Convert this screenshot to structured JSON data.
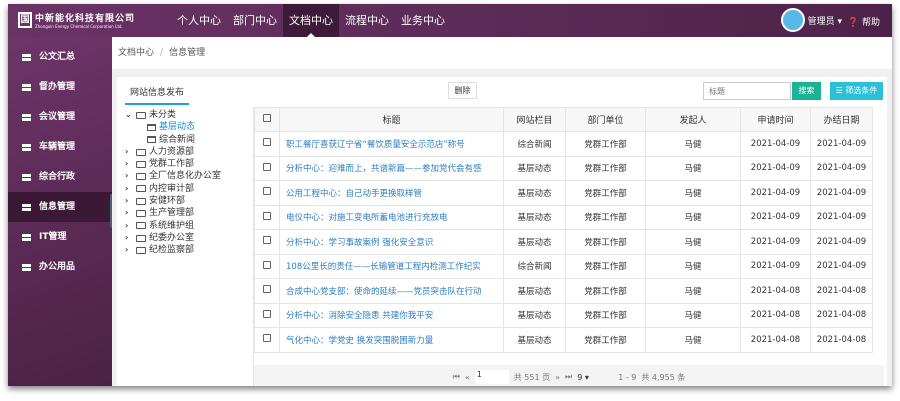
{
  "brand": {
    "name_cn": "中新能化科技有限公司",
    "name_en": "Zhongxin Energy Chemical Corporation Ltd.",
    "mark": "国"
  },
  "nav": [
    {
      "label": "个人中心"
    },
    {
      "label": "部门中心"
    },
    {
      "label": "文档中心",
      "active": true
    },
    {
      "label": "流程中心"
    },
    {
      "label": "业务中心"
    }
  ],
  "user": {
    "name": "管理员 ▾",
    "help": "帮助"
  },
  "sidebar": [
    {
      "label": "公文汇总"
    },
    {
      "label": "督办管理"
    },
    {
      "label": "会议管理"
    },
    {
      "label": "车辆管理"
    },
    {
      "label": "综合行政"
    },
    {
      "label": "信息管理",
      "active": true
    },
    {
      "label": "IT管理"
    },
    {
      "label": "办公用品"
    }
  ],
  "breadcrumb": {
    "root": "文档中心",
    "sep": "/",
    "current": "信息管理"
  },
  "tab": "网站信息发布",
  "toolbar": {
    "delete": "删除",
    "search_placeholder": "标题",
    "search": "搜索",
    "filter": "筛选条件"
  },
  "tree": {
    "root": "未分类",
    "children": [
      "基层动态",
      "综合新闻"
    ],
    "selected": "基层动态",
    "departments": [
      "人力资源部",
      "党群工作部",
      "全厂信息化办公室",
      "内控审计部",
      "安健环部",
      "生产管理部",
      "系统维护组",
      "纪委办公室",
      "纪检监察部"
    ]
  },
  "table": {
    "columns": [
      "标题",
      "网站栏目",
      "部门单位",
      "发起人",
      "申请时间",
      "办结日期"
    ],
    "rows": [
      [
        "职工餐厅喜获辽宁省“餐饮质量安全示范店”称号",
        "综合新闻",
        "党群工作部",
        "马健",
        "2021-04-09",
        "2021-04-09"
      ],
      [
        "分析中心：迎难而上，共谱新篇——参加党代会有感",
        "基层动态",
        "党群工作部",
        "马健",
        "2021-04-09",
        "2021-04-09"
      ],
      [
        "公用工程中心：自己动手更换取样管",
        "基层动态",
        "党群工作部",
        "马健",
        "2021-04-09",
        "2021-04-09"
      ],
      [
        "电仪中心：对施工变电所蓄电池进行充放电",
        "基层动态",
        "党群工作部",
        "马健",
        "2021-04-09",
        "2021-04-09"
      ],
      [
        "分析中心：学习事故案例 强化安全意识",
        "基层动态",
        "党群工作部",
        "马健",
        "2021-04-09",
        "2021-04-09"
      ],
      [
        "108公里长的责任——长输管道工程内检测工作纪实",
        "综合新闻",
        "党群工作部",
        "马健",
        "2021-04-09",
        "2021-04-09"
      ],
      [
        "合成中心党支部：使命的延续——党员突击队在行动",
        "基层动态",
        "党群工作部",
        "马健",
        "2021-04-08",
        "2021-04-08"
      ],
      [
        "分析中心：消除安全隐患 共建你我平安",
        "基层动态",
        "党群工作部",
        "马健",
        "2021-04-08",
        "2021-04-08"
      ],
      [
        "气化中心：学党史 换发突围脱困新力量",
        "基层动态",
        "党群工作部",
        "马健",
        "2021-04-08",
        "2021-04-08"
      ]
    ]
  },
  "pager": {
    "first": "⏮",
    "prev": "«",
    "page": "1",
    "total_pages": "共 551 页",
    "next": "»",
    "last": "⏭",
    "page_size": "9",
    "range": "1 - 9",
    "total": "共 4,955 条"
  }
}
